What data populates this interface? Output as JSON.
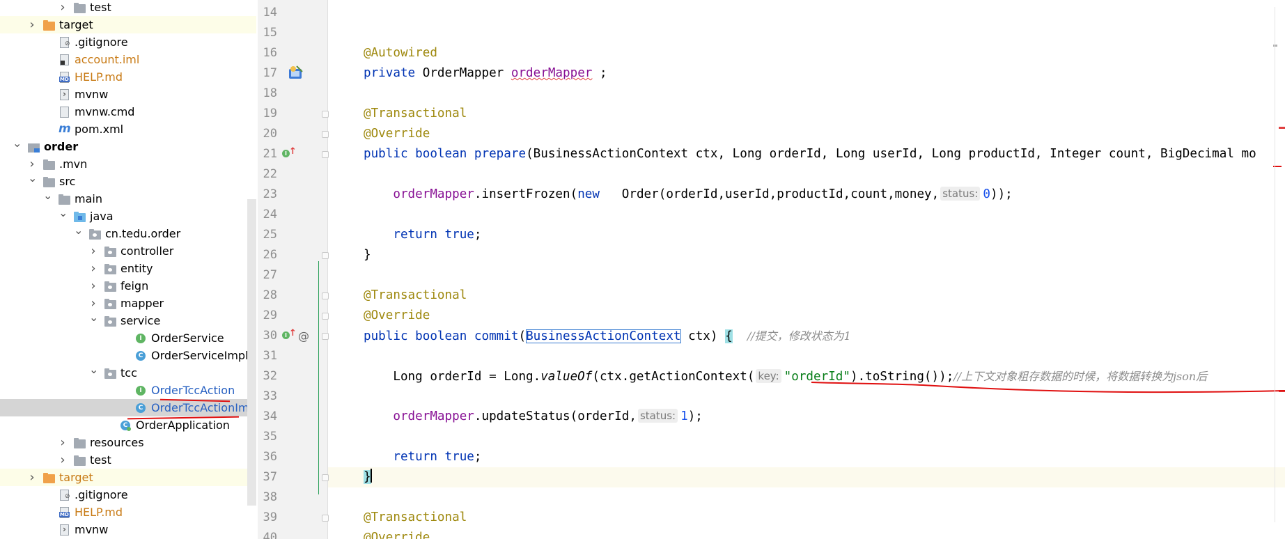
{
  "tree": {
    "items": [
      {
        "label": "test",
        "kind": "folder",
        "indent": 3,
        "arrow": "right"
      },
      {
        "label": "target",
        "kind": "folder-orange",
        "indent": 1,
        "arrow": "right",
        "highlight": true
      },
      {
        "label": ".gitignore",
        "kind": "file-git",
        "indent": 2
      },
      {
        "label": "account.iml",
        "kind": "file-iml",
        "indent": 2,
        "color": "orange"
      },
      {
        "label": "HELP.md",
        "kind": "file-md",
        "indent": 2,
        "color": "orange"
      },
      {
        "label": "mvnw",
        "kind": "file-sh",
        "indent": 2
      },
      {
        "label": "mvnw.cmd",
        "kind": "file",
        "indent": 2
      },
      {
        "label": "pom.xml",
        "kind": "maven",
        "indent": 2
      },
      {
        "label": "order",
        "kind": "module",
        "indent": 0,
        "arrow": "down",
        "bold": true
      },
      {
        "label": ".mvn",
        "kind": "folder",
        "indent": 1,
        "arrow": "right"
      },
      {
        "label": "src",
        "kind": "folder",
        "indent": 1,
        "arrow": "down"
      },
      {
        "label": "main",
        "kind": "folder",
        "indent": 2,
        "arrow": "down"
      },
      {
        "label": "java",
        "kind": "folder-blue",
        "indent": 3,
        "arrow": "down"
      },
      {
        "label": "cn.tedu.order",
        "kind": "package",
        "indent": 4,
        "arrow": "down"
      },
      {
        "label": "controller",
        "kind": "package",
        "indent": 5,
        "arrow": "right"
      },
      {
        "label": "entity",
        "kind": "package",
        "indent": 5,
        "arrow": "right"
      },
      {
        "label": "feign",
        "kind": "package",
        "indent": 5,
        "arrow": "right"
      },
      {
        "label": "mapper",
        "kind": "package",
        "indent": 5,
        "arrow": "right"
      },
      {
        "label": "service",
        "kind": "package",
        "indent": 5,
        "arrow": "down"
      },
      {
        "label": "OrderService",
        "kind": "interface",
        "indent": 7
      },
      {
        "label": "OrderServiceImpl",
        "kind": "class",
        "indent": 7
      },
      {
        "label": "tcc",
        "kind": "package",
        "indent": 5,
        "arrow": "down"
      },
      {
        "label": "OrderTccAction",
        "kind": "interface",
        "indent": 7,
        "color": "blue"
      },
      {
        "label": "OrderTccActionImpl",
        "kind": "class",
        "indent": 7,
        "color": "blue",
        "selected": true
      },
      {
        "label": "OrderApplication",
        "kind": "app",
        "indent": 6
      },
      {
        "label": "resources",
        "kind": "folder",
        "indent": 3,
        "arrow": "right"
      },
      {
        "label": "test",
        "kind": "folder",
        "indent": 3,
        "arrow": "right"
      },
      {
        "label": "target",
        "kind": "folder-orange",
        "indent": 1,
        "arrow": "right",
        "highlight": true,
        "color": "orange"
      },
      {
        "label": ".gitignore",
        "kind": "file-git",
        "indent": 2
      },
      {
        "label": "HELP.md",
        "kind": "file-md",
        "indent": 2,
        "color": "orange"
      },
      {
        "label": "mvnw",
        "kind": "file-sh",
        "indent": 2
      }
    ]
  },
  "editor": {
    "lines": [
      {
        "n": "14"
      },
      {
        "n": "15"
      },
      {
        "n": "16",
        "t": [
          [
            "@Autowired",
            "ann"
          ]
        ]
      },
      {
        "n": "17",
        "t": [
          [
            "private ",
            "kw"
          ],
          [
            "OrderMapper ",
            ""
          ],
          [
            "orderMapper",
            "fld squig"
          ],
          [
            " ;",
            ""
          ]
        ]
      },
      {
        "n": "18"
      },
      {
        "n": "19",
        "t": [
          [
            "@Transactional",
            "ann"
          ]
        ]
      },
      {
        "n": "20",
        "t": [
          [
            "@Override",
            "ann"
          ]
        ]
      },
      {
        "n": "21",
        "t": [
          [
            "public ",
            "kw"
          ],
          [
            "boolean ",
            "kw"
          ],
          [
            "prepare",
            "kw"
          ],
          [
            "(BusinessActionContext ctx, Long orderId, Long userId, Long productId, Integer count, BigDecimal mo",
            ""
          ]
        ]
      },
      {
        "n": "22"
      },
      {
        "n": "23",
        "t": [
          [
            "    ",
            ""
          ],
          [
            "orderMapper",
            "fld"
          ],
          [
            ".insertFrozen(",
            ""
          ],
          [
            "new ",
            "kw"
          ],
          [
            "  Order(orderId,userId,productId,count,money,",
            ""
          ],
          [
            "status:",
            "hint"
          ],
          [
            "0",
            "num"
          ],
          [
            "));",
            ""
          ]
        ]
      },
      {
        "n": "24"
      },
      {
        "n": "25",
        "t": [
          [
            "    ",
            ""
          ],
          [
            "return ",
            "kw"
          ],
          [
            "true",
            "kw"
          ],
          [
            ";",
            ""
          ]
        ]
      },
      {
        "n": "26",
        "t": [
          [
            "}",
            ""
          ]
        ]
      },
      {
        "n": "27"
      },
      {
        "n": "28",
        "t": [
          [
            "@Transactional",
            "ann"
          ]
        ]
      },
      {
        "n": "29",
        "t": [
          [
            "@Override",
            "ann"
          ]
        ]
      },
      {
        "n": "30",
        "t": [
          [
            "public ",
            "kw"
          ],
          [
            "boolean ",
            "kw"
          ],
          [
            "commit",
            "kw"
          ],
          [
            "(",
            ""
          ],
          [
            "BusinessActionContext",
            "boxed"
          ],
          [
            " ctx) ",
            ""
          ],
          [
            "{",
            "braceH"
          ],
          [
            "  ",
            ""
          ],
          [
            "//提交，修改状态为1",
            "cmt"
          ]
        ]
      },
      {
        "n": "31"
      },
      {
        "n": "32",
        "t": [
          [
            "    Long orderId = Long.",
            ""
          ],
          [
            "valueOf",
            "it"
          ],
          [
            "(ctx.getActionContext(",
            ""
          ],
          [
            "key:",
            "hint"
          ],
          [
            "\"orderId\"",
            "str"
          ],
          [
            ").toString());",
            ""
          ],
          [
            "//上下文对象粗存数据的时候，将数据转换为json后",
            "cmt"
          ]
        ]
      },
      {
        "n": "33"
      },
      {
        "n": "34",
        "t": [
          [
            "    ",
            ""
          ],
          [
            "orderMapper",
            "fld"
          ],
          [
            ".updateStatus(orderId,",
            ""
          ],
          [
            "status:",
            "hint"
          ],
          [
            "1",
            "num"
          ],
          [
            ");",
            ""
          ]
        ]
      },
      {
        "n": "35"
      },
      {
        "n": "36",
        "t": [
          [
            "    ",
            ""
          ],
          [
            "return ",
            "kw"
          ],
          [
            "true",
            "kw"
          ],
          [
            ";",
            ""
          ]
        ]
      },
      {
        "n": "37",
        "t": [
          [
            "}",
            "braceH"
          ]
        ],
        "current": true
      },
      {
        "n": "38"
      },
      {
        "n": "39",
        "t": [
          [
            "@Transactional",
            "ann"
          ]
        ]
      },
      {
        "n": "40",
        "t": [
          [
            "@Override",
            "ann"
          ]
        ]
      }
    ]
  },
  "colors": {
    "keyword": "#0033b3",
    "annotation": "#9e880d",
    "field": "#871094",
    "string": "#067d17",
    "number": "#1750eb",
    "comment": "#8c8c8c",
    "redPen": "#e01010"
  }
}
